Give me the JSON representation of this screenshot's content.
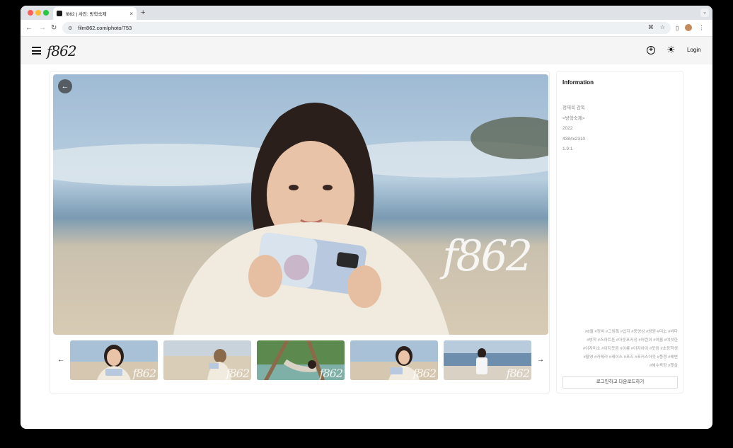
{
  "browser": {
    "tab_title": "f862 | 사진: 방학숙제",
    "tab_close": "×",
    "new_tab": "+",
    "tab_menu": "⌄",
    "url": "film862.com/photo/753"
  },
  "header": {
    "logo": "f862",
    "login_label": "Login"
  },
  "photo": {
    "watermark": "f862"
  },
  "thumbnails": [
    {
      "watermark": "f862"
    },
    {
      "watermark": "f862"
    },
    {
      "watermark": "f862"
    },
    {
      "watermark": "f862"
    },
    {
      "watermark": "f862"
    }
  ],
  "info": {
    "title": "Information",
    "director": "정재욱 감독",
    "film": "<방학숙제>",
    "year": "2022",
    "resolution": "4384x2310",
    "aspect_ratio": "1.9:1",
    "tags": [
      "#8월 #정치 #그림톡 #입지 #동영상 #방원 #미소 #바다",
      "#방학 #스마트폰 #아웃포커싱 #어린이 #여름 #여섯한",
      "#이자미소 #이지웃음 #이름 #이자아이 #웃음 #초등학생",
      "#촬영 #카메라 #케이스 #포즈 #포커스아웃 #풍경 #해변",
      "#해수욕장 #햇살"
    ],
    "download_label": "로그인하고 다운로드하기"
  },
  "colors": {
    "background": "#000000",
    "header_bg": "#f5f5f5",
    "muted_text": "#888888"
  }
}
